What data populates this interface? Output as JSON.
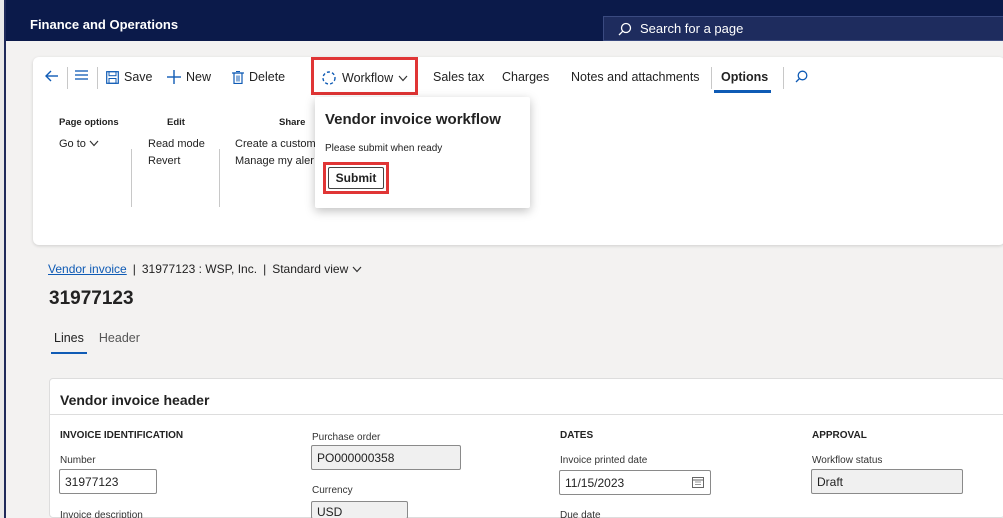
{
  "header": {
    "app_title": "Finance and Operations",
    "search_placeholder": "Search for a page"
  },
  "toolbar": {
    "save": "Save",
    "new": "New",
    "delete": "Delete",
    "workflow": "Workflow",
    "sales_tax": "Sales tax",
    "charges": "Charges",
    "notes": "Notes and attachments",
    "options": "Options"
  },
  "ribbon": {
    "page_options": {
      "title": "Page options",
      "items": [
        "Go to"
      ]
    },
    "edit": {
      "title": "Edit",
      "items": [
        "Read mode",
        "Revert"
      ]
    },
    "share": {
      "title": "Share",
      "items": [
        "Create a custom",
        "Manage my aler"
      ]
    }
  },
  "flyout": {
    "title": "Vendor invoice workflow",
    "message": "Please submit when ready",
    "submit": "Submit"
  },
  "breadcrumb": {
    "link": "Vendor invoice",
    "separator": "|",
    "record": "31977123 : WSP, Inc.",
    "view": "Standard view"
  },
  "record_title": "31977123",
  "tabs": [
    "Lines",
    "Header"
  ],
  "panel": {
    "title": "Vendor invoice header",
    "invoice_identification": {
      "title": "INVOICE IDENTIFICATION",
      "number_label": "Number",
      "number_value": "31977123",
      "description_label": "Invoice description"
    },
    "purchase": {
      "po_label": "Purchase order",
      "po_value": "PO000000358",
      "currency_label": "Currency",
      "currency_value": "USD"
    },
    "dates": {
      "title": "DATES",
      "printed_label": "Invoice printed date",
      "printed_value": "11/15/2023",
      "due_label": "Due date"
    },
    "approval": {
      "title": "APPROVAL",
      "status_label": "Workflow status",
      "status_value": "Draft"
    }
  },
  "colors": {
    "accent": "#0f5bb5",
    "topbar": "#0b1a4a",
    "highlight": "#e03535"
  }
}
